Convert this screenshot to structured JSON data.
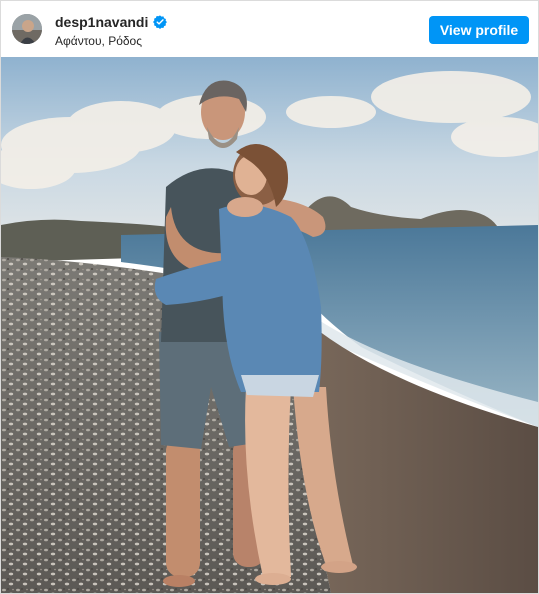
{
  "header": {
    "username": "desp1navandi",
    "verified_icon": "verified-badge-icon",
    "location": "Αφάντου, Ρόδος",
    "view_profile_label": "View profile",
    "accent_color": "#0095f6"
  },
  "post": {
    "image_description_icon": "post-photo"
  }
}
